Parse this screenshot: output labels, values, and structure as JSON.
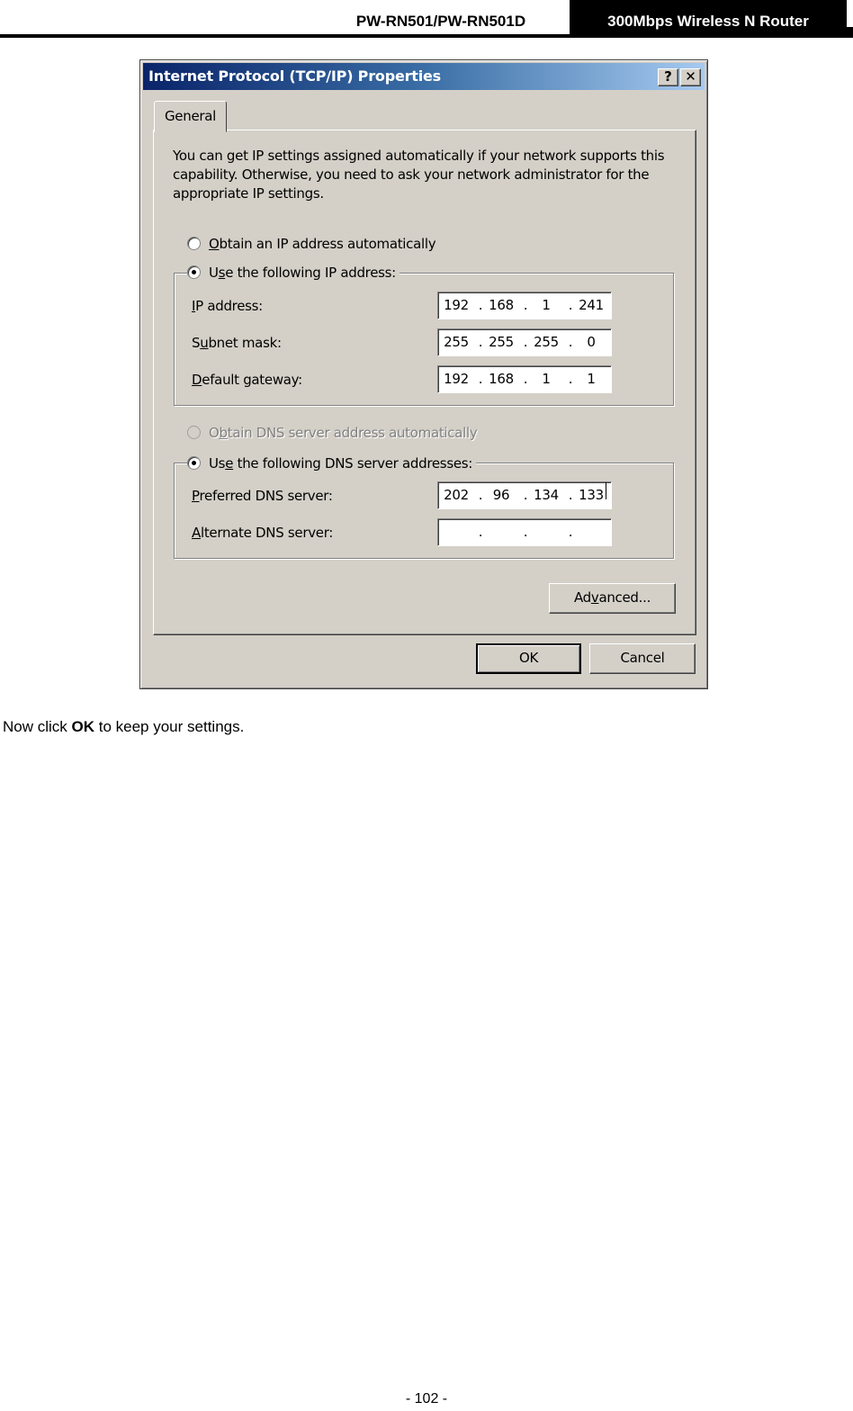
{
  "header": {
    "model": "PW-RN501/PW-RN501D",
    "product": "300Mbps Wireless N Router"
  },
  "dialog": {
    "title": "Internet Protocol (TCP/IP) Properties",
    "help_button": "?",
    "close_button": "✕",
    "tab_label": "General",
    "description": "You can get IP settings assigned automatically if your network supports this capability. Otherwise, you need to ask your network administrator for the appropriate IP settings.",
    "ip_auto_option": {
      "pre": "",
      "key": "O",
      "post": "btain an IP address automatically",
      "checked": false
    },
    "ip_manual_option": {
      "pre": "U",
      "key": "s",
      "post": "e the following IP address:",
      "checked": true
    },
    "ip_fields": [
      {
        "pre": "",
        "key": "I",
        "post": "P address:",
        "octets": [
          "192",
          "168",
          "1",
          "241"
        ]
      },
      {
        "pre": "S",
        "key": "u",
        "post": "bnet mask:",
        "octets": [
          "255",
          "255",
          "255",
          "0"
        ]
      },
      {
        "pre": "",
        "key": "D",
        "post": "efault gateway:",
        "octets": [
          "192",
          "168",
          "1",
          "1"
        ]
      }
    ],
    "dns_auto_option": {
      "pre": "O",
      "key": "b",
      "post": "tain DNS server address automatically",
      "checked": false,
      "disabled": true
    },
    "dns_manual_option": {
      "pre": "Us",
      "key": "e",
      "post": " the following DNS server addresses:",
      "checked": true
    },
    "dns_fields": [
      {
        "pre": "",
        "key": "P",
        "post": "referred DNS server:",
        "octets": [
          "202",
          "96",
          "134",
          "133"
        ]
      },
      {
        "pre": "",
        "key": "A",
        "post": "lternate DNS server:",
        "octets": [
          "",
          "",
          "",
          ""
        ]
      }
    ],
    "advanced_button": {
      "pre": "Ad",
      "key": "v",
      "post": "anced..."
    },
    "ok_button": "OK",
    "cancel_button": "Cancel"
  },
  "instruction": {
    "before": "Now click ",
    "bold": "OK",
    "after": " to keep your settings."
  },
  "footer": {
    "page_number": "- 102 -"
  }
}
